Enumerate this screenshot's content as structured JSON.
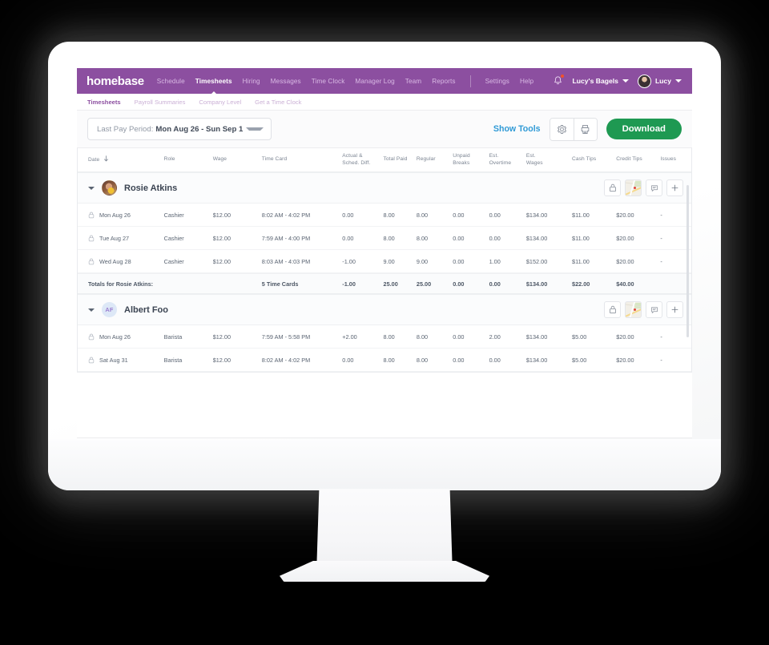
{
  "topnav": {
    "brand": "homebase",
    "links": [
      {
        "label": "Schedule",
        "active": false
      },
      {
        "label": "Timesheets",
        "active": true
      },
      {
        "label": "Hiring",
        "active": false
      },
      {
        "label": "Messages",
        "active": false
      },
      {
        "label": "Time Clock",
        "active": false
      },
      {
        "label": "Manager Log",
        "active": false
      },
      {
        "label": "Team",
        "active": false
      },
      {
        "label": "Reports",
        "active": false
      }
    ],
    "links_right": [
      {
        "label": "Settings"
      },
      {
        "label": "Help"
      }
    ],
    "notification_icon": "bell-icon",
    "location_name": "Lucy's Bagels",
    "user_name": "Lucy"
  },
  "subnav": {
    "items": [
      {
        "label": "Timesheets",
        "active": true
      },
      {
        "label": "Payroll Summaries",
        "active": false
      },
      {
        "label": "Company Level",
        "active": false
      },
      {
        "label": "Get a Time Clock",
        "active": false
      }
    ]
  },
  "toolbar": {
    "period_label": "Last Pay Period:",
    "period_value": "Mon Aug 26 - Sun Sep 1",
    "show_tools": "Show Tools",
    "settings_icon": "gear-icon",
    "print_icon": "printer-icon",
    "download_label": "Download"
  },
  "table": {
    "columns": [
      {
        "key": "date",
        "line1": "Date",
        "line2": "",
        "sort": "down"
      },
      {
        "key": "role",
        "line1": "Role",
        "line2": ""
      },
      {
        "key": "wage",
        "line1": "Wage",
        "line2": ""
      },
      {
        "key": "time_card",
        "line1": "Time Card",
        "line2": ""
      },
      {
        "key": "diff",
        "line1": "Actual &",
        "line2": "Sched. Diff."
      },
      {
        "key": "total_paid",
        "line1": "Total Paid",
        "line2": ""
      },
      {
        "key": "regular",
        "line1": "Regular",
        "line2": ""
      },
      {
        "key": "unpaid_breaks",
        "line1": "Unpaid",
        "line2": "Breaks"
      },
      {
        "key": "est_overtime",
        "line1": "Est.",
        "line2": "Overtime"
      },
      {
        "key": "est_wages",
        "line1": "Est.",
        "line2": "Wages"
      },
      {
        "key": "cash_tips",
        "line1": "Cash Tips",
        "line2": ""
      },
      {
        "key": "credit_tips",
        "line1": "Credit Tips",
        "line2": ""
      },
      {
        "key": "issues",
        "line1": "Issues",
        "line2": ""
      }
    ],
    "groups": [
      {
        "name": "Rosie Atkins",
        "avatar_type": "photo",
        "avatar_initials": "",
        "actions": [
          "lock-icon",
          "map-thumbnail-icon",
          "comment-icon",
          "plus-icon"
        ],
        "rows": [
          {
            "lock": "lock-icon",
            "date": "Mon Aug 26",
            "role": "Cashier",
            "wage": "$12.00",
            "time_card": "8:02 AM - 4:02 PM",
            "diff": "0.00",
            "total_paid": "8.00",
            "regular": "8.00",
            "unpaid_breaks": "0.00",
            "est_overtime": "0.00",
            "est_wages": "$134.00",
            "cash_tips": "$11.00",
            "credit_tips": "$20.00",
            "issues": "-"
          },
          {
            "lock": "lock-icon",
            "date": "Tue Aug 27",
            "role": "Cashier",
            "wage": "$12.00",
            "time_card": "7:59 AM - 4:00 PM",
            "diff": "0.00",
            "total_paid": "8.00",
            "regular": "8.00",
            "unpaid_breaks": "0.00",
            "est_overtime": "0.00",
            "est_wages": "$134.00",
            "cash_tips": "$11.00",
            "credit_tips": "$20.00",
            "issues": "-"
          },
          {
            "lock": "lock-icon",
            "date": "Wed Aug 28",
            "role": "Cashier",
            "wage": "$12.00",
            "time_card": "8:03 AM - 4:03 PM",
            "diff": "-1.00",
            "total_paid": "9.00",
            "regular": "9.00",
            "unpaid_breaks": "0.00",
            "est_overtime": "1.00",
            "est_wages": "$152.00",
            "cash_tips": "$11.00",
            "credit_tips": "$20.00",
            "issues": "-"
          }
        ],
        "totals": {
          "label": "Totals for Rosie Atkins:",
          "time_card": "5 Time Cards",
          "diff": "-1.00",
          "total_paid": "25.00",
          "regular": "25.00",
          "unpaid_breaks": "0.00",
          "est_overtime": "0.00",
          "est_wages": "$134.00",
          "cash_tips": "$22.00",
          "credit_tips": "$40.00"
        }
      },
      {
        "name": "Albert Foo",
        "avatar_type": "initials",
        "avatar_initials": "AF",
        "actions": [
          "lock-icon",
          "map-thumbnail-icon",
          "comment-icon",
          "plus-icon"
        ],
        "rows": [
          {
            "lock": "lock-icon",
            "date": "Mon Aug 26",
            "role": "Barista",
            "wage": "$12.00",
            "time_card": "7:59 AM - 5:58 PM",
            "diff": "+2.00",
            "total_paid": "8.00",
            "regular": "8.00",
            "unpaid_breaks": "0.00",
            "est_overtime": "2.00",
            "est_wages": "$134.00",
            "cash_tips": "$5.00",
            "credit_tips": "$20.00",
            "issues": "-"
          },
          {
            "lock": "lock-icon",
            "date": "Sat Aug 31",
            "role": "Barista",
            "wage": "$12.00",
            "time_card": "8:02 AM - 4:02 PM",
            "diff": "0.00",
            "total_paid": "8.00",
            "regular": "8.00",
            "unpaid_breaks": "0.00",
            "est_overtime": "0.00",
            "est_wages": "$134.00",
            "cash_tips": "$5.00",
            "credit_tips": "$20.00",
            "issues": "-"
          }
        ],
        "totals": null
      }
    ]
  },
  "colors": {
    "brand_purple": "#8c4fa0",
    "download_green": "#1e9952",
    "link_blue": "#2f9ad6"
  }
}
